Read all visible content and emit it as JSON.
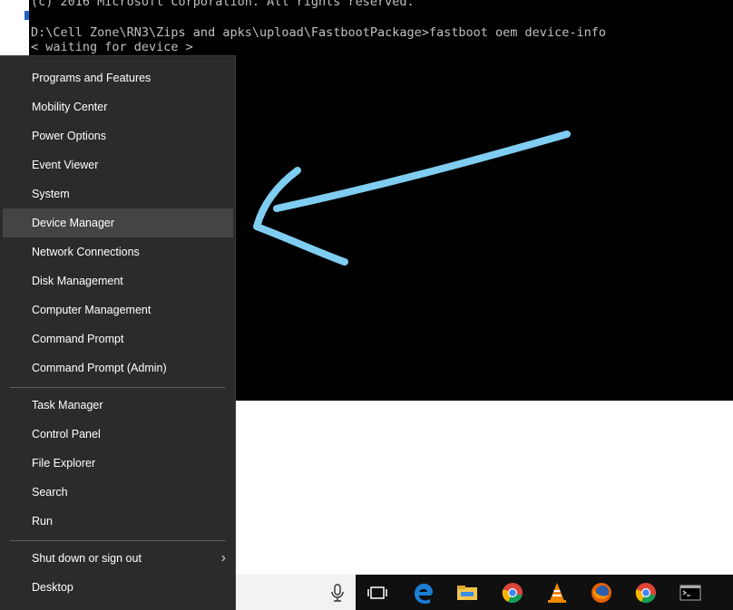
{
  "console": {
    "lines": [
      "(c) 2016 Microsoft Corporation. All rights reserved.",
      "D:\\Cell Zone\\RN3\\Zips and apks\\upload\\FastbootPackage>fastboot oem device-info",
      "< waiting for device >"
    ]
  },
  "menu": {
    "items": [
      {
        "label": "Programs and Features"
      },
      {
        "label": "Mobility Center"
      },
      {
        "label": "Power Options"
      },
      {
        "label": "Event Viewer"
      },
      {
        "label": "System"
      },
      {
        "label": "Device Manager",
        "highlighted": true
      },
      {
        "label": "Network Connections"
      },
      {
        "label": "Disk Management"
      },
      {
        "label": "Computer Management"
      },
      {
        "label": "Command Prompt"
      },
      {
        "label": "Command Prompt (Admin)"
      },
      {
        "label": "Task Manager"
      },
      {
        "label": "Control Panel"
      },
      {
        "label": "File Explorer"
      },
      {
        "label": "Search"
      },
      {
        "label": "Run"
      },
      {
        "label": "Shut down or sign out",
        "has_submenu": true
      },
      {
        "label": "Desktop"
      }
    ]
  },
  "annotation": {
    "color": "#7fcdf0"
  },
  "taskbar": {
    "icons": [
      "microphone-icon",
      "task-view-icon",
      "edge-icon",
      "file-explorer-icon",
      "chrome-icon",
      "vlc-icon",
      "firefox-icon",
      "chrome-icon",
      "command-prompt-icon"
    ]
  }
}
